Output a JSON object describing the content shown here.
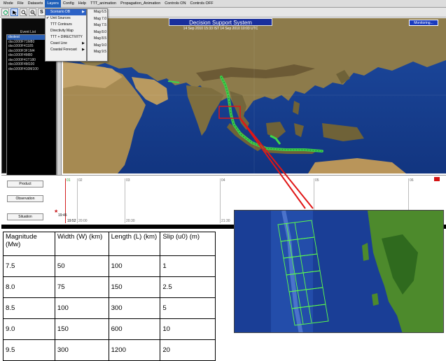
{
  "menu": {
    "items": [
      "Mode",
      "File",
      "Datasets",
      "Layers",
      "Config",
      "Help",
      "TTT_animation",
      "Propagation_Animation",
      "Controls ON",
      "Controls OFF"
    ],
    "active": "Layers"
  },
  "toolbar": {
    "s_label": "S",
    "u_label": "U"
  },
  "layers_menu": {
    "items": [
      {
        "label": "Scenario DB",
        "arrow": true,
        "highlighted": true
      },
      {
        "label": "Unit Sources",
        "checked": true
      },
      {
        "label": "TTT Contours"
      },
      {
        "label": "Directivity Map"
      },
      {
        "label": "TTT + DIRECTIVITY"
      },
      {
        "label": "Coast Line",
        "arrow": true
      },
      {
        "label": "Coastal Forecast",
        "arrow": true
      }
    ],
    "check_mark": "✔",
    "arrow_glyph": "▶"
  },
  "scenario_menu": {
    "items": [
      "Mag 6.5",
      "Mag 7.0",
      "Mag 7.5",
      "Mag 8.0",
      "Mag 8.5",
      "Mag 9.0",
      "Mag 9.5"
    ]
  },
  "event_list": {
    "title": "Event List",
    "items": [
      "dsstest",
      "dss1000F71M80",
      "dss1000F41185",
      "dss1000F3F1M4",
      "dss1000F4M80",
      "dss1000F41T180",
      "dss1000F4M100",
      "dss1000F410M100"
    ]
  },
  "dss": {
    "title": "Decision Support System",
    "time": "14 Sep 2010 15:33 IST   14 Sep 2010 10:03 UTC",
    "monitor_button": "Monitoring..."
  },
  "timeline": {
    "buttons": [
      "Product",
      "Observation",
      "Situation"
    ],
    "markers": [
      "01",
      "02",
      "03",
      "04",
      "05",
      "06"
    ],
    "lower_labels": [
      "19:52",
      "20:00",
      "20:30",
      "21:30"
    ],
    "event_time": "19:45"
  },
  "table": {
    "headers": [
      "Magnitude (Mw)",
      "Width (W) (km)",
      "Length (L) (km)",
      "Slip (u0) (m)"
    ],
    "rows": [
      [
        "7.5",
        "50",
        "100",
        "1"
      ],
      [
        "8.0",
        "75",
        "150",
        "2.5"
      ],
      [
        "8.5",
        "100",
        "300",
        "5"
      ],
      [
        "9.0",
        "150",
        "600",
        "10"
      ],
      [
        "9.5",
        "300",
        "1200",
        "20"
      ]
    ]
  },
  "colors": {
    "dss_title_bg": "#1a2f9c",
    "menu_highlight": "#2c62c6",
    "ocean": "#173f93",
    "land": "#8f7a4a",
    "source_green": "#3cd64a",
    "zoom_red": "#e01616"
  }
}
